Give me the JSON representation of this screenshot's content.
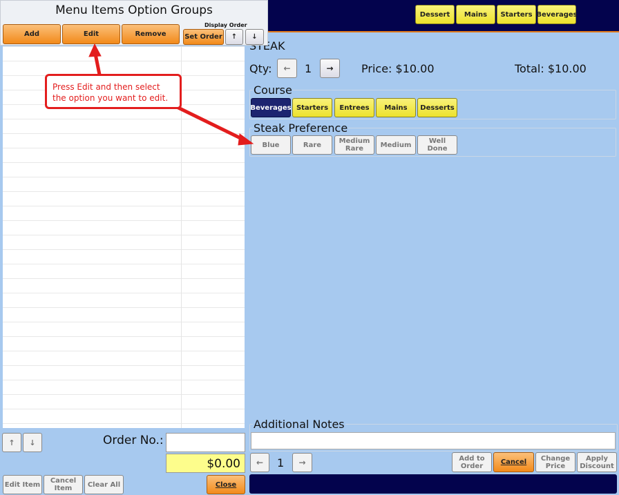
{
  "dialog": {
    "title": "Menu Items Option Groups",
    "add": "Add",
    "edit": "Edit",
    "remove": "Remove",
    "display_order": "Display Order",
    "set_order": "Set Order",
    "up": "↑",
    "down": "↓"
  },
  "callout": {
    "text": "Press Edit and then select the option you want to edit."
  },
  "header": {
    "categories": [
      "Dessert",
      "Mains",
      "Starters",
      "Beverages"
    ]
  },
  "item": {
    "name": "STEAK",
    "qty_label": "Qty:",
    "qty": "1",
    "dec": "←",
    "inc": "→",
    "price": "Price: $10.00",
    "total": "Total: $10.00"
  },
  "course": {
    "label": "Course",
    "options": [
      "Beverages",
      "Starters",
      "Entrees",
      "Mains",
      "Desserts"
    ],
    "selected": "Beverages"
  },
  "preference": {
    "label": "Steak Preference",
    "options": [
      "Blue",
      "Rare",
      "Medium Rare",
      "Medium",
      "Well Done"
    ]
  },
  "notes": {
    "label": "Additional Notes",
    "value": ""
  },
  "footer_right": {
    "qty": "1",
    "dec": "←",
    "inc": "→",
    "add_to_order": "Add to Order",
    "cancel": "Cancel",
    "change_price": "Change Price",
    "apply_discount": "Apply Discount"
  },
  "footer_left": {
    "up": "↑",
    "down": "↓",
    "order_no_label": "Order No.:",
    "order_no": "",
    "amount": "$0.00",
    "edit_item": "Edit Item",
    "cancel_item": "Cancel Item",
    "clear_all": "Clear All",
    "close": "Close"
  }
}
